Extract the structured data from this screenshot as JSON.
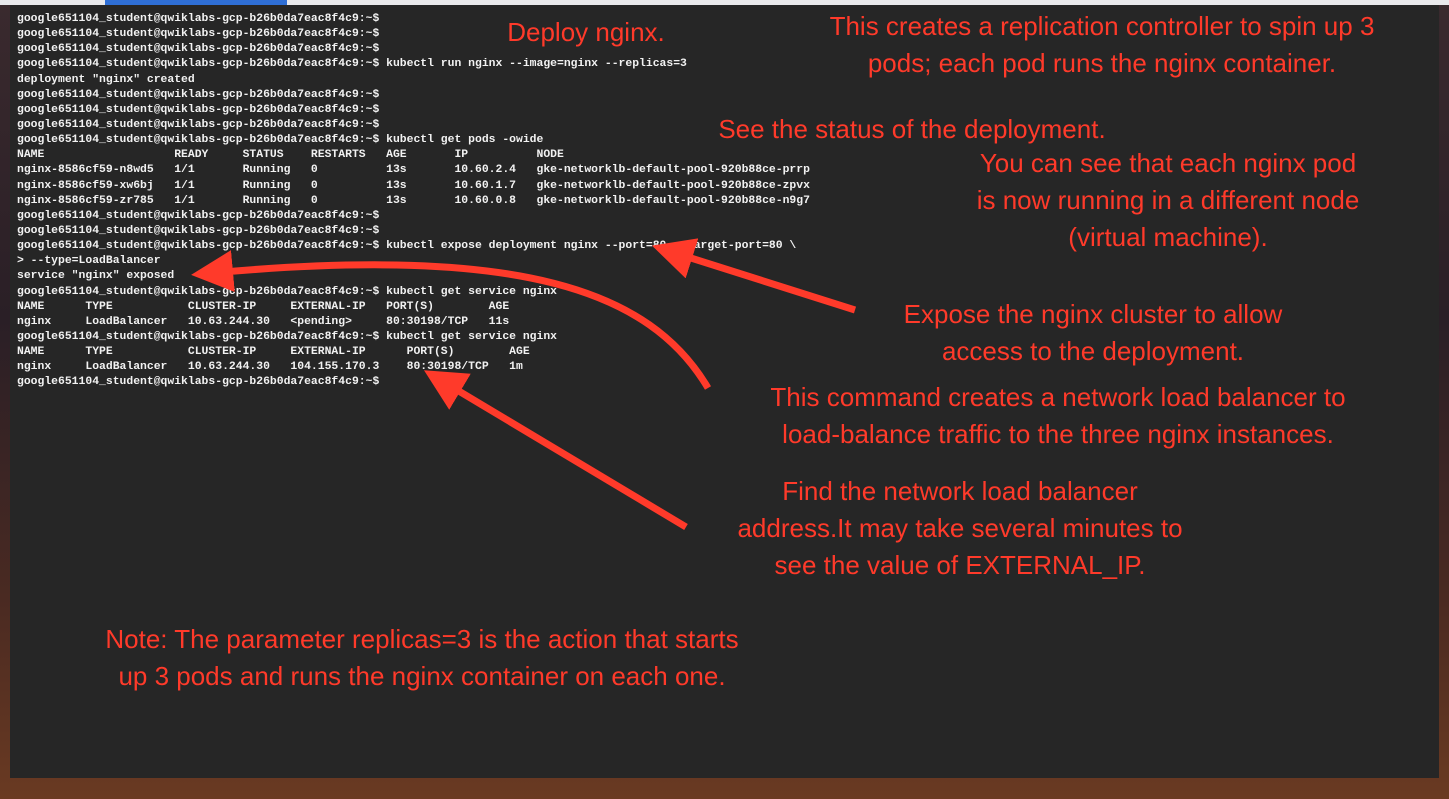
{
  "colors": {
    "terminal_bg": "#262626",
    "terminal_text": "#f2f2f2",
    "annotation_red": "#ff3a2a",
    "cursor": "#b8283a",
    "top_accent": "#2f6fd6"
  },
  "terminal": {
    "lines": [
      "google651104_student@qwiklabs-gcp-b26b0da7eac8f4c9:~$",
      "google651104_student@qwiklabs-gcp-b26b0da7eac8f4c9:~$",
      "google651104_student@qwiklabs-gcp-b26b0da7eac8f4c9:~$",
      "google651104_student@qwiklabs-gcp-b26b0da7eac8f4c9:~$ kubectl run nginx --image=nginx --replicas=3",
      "deployment \"nginx\" created",
      "google651104_student@qwiklabs-gcp-b26b0da7eac8f4c9:~$",
      "google651104_student@qwiklabs-gcp-b26b0da7eac8f4c9:~$",
      "google651104_student@qwiklabs-gcp-b26b0da7eac8f4c9:~$",
      "google651104_student@qwiklabs-gcp-b26b0da7eac8f4c9:~$ kubectl get pods -owide",
      "NAME                   READY     STATUS    RESTARTS   AGE       IP          NODE",
      "nginx-8586cf59-n8wd5   1/1       Running   0          13s       10.60.2.4   gke-networklb-default-pool-920b88ce-prrp",
      "nginx-8586cf59-xw6bj   1/1       Running   0          13s       10.60.1.7   gke-networklb-default-pool-920b88ce-zpvx",
      "nginx-8586cf59-zr785   1/1       Running   0          13s       10.60.0.8   gke-networklb-default-pool-920b88ce-n9g7",
      "google651104_student@qwiklabs-gcp-b26b0da7eac8f4c9:~$",
      "google651104_student@qwiklabs-gcp-b26b0da7eac8f4c9:~$",
      "google651104_student@qwiklabs-gcp-b26b0da7eac8f4c9:~$ kubectl expose deployment nginx --port=80 --target-port=80 \\",
      "> --type=LoadBalancer",
      "service \"nginx\" exposed",
      "google651104_student@qwiklabs-gcp-b26b0da7eac8f4c9:~$ kubectl get service nginx",
      "NAME      TYPE           CLUSTER-IP     EXTERNAL-IP   PORT(S)        AGE",
      "nginx     LoadBalancer   10.63.244.30   <pending>     80:30198/TCP   11s",
      "google651104_student@qwiklabs-gcp-b26b0da7eac8f4c9:~$ kubectl get service nginx",
      "NAME      TYPE           CLUSTER-IP     EXTERNAL-IP      PORT(S)        AGE",
      "nginx     LoadBalancer   10.63.244.30   104.155.170.3    80:30198/TCP   1m",
      "google651104_student@qwiklabs-gcp-b26b0da7eac8f4c9:~$"
    ]
  },
  "annotations": {
    "deploy": {
      "lines": [
        "Deploy nginx."
      ]
    },
    "replication": {
      "lines": [
        "This creates a replication controller to spin up 3",
        "pods; each pod runs the nginx container."
      ]
    },
    "status": {
      "lines": [
        "See the status of the deployment."
      ]
    },
    "nodes": {
      "lines": [
        "You can see that each nginx pod",
        "is now running in a different node",
        "(virtual machine)."
      ]
    },
    "expose": {
      "lines": [
        "Expose the nginx cluster to allow",
        "access to the deployment."
      ]
    },
    "loadbalancer": {
      "lines": [
        "This command creates a network load balancer to",
        "load-balance traffic to the three nginx instances."
      ]
    },
    "find": {
      "lines": [
        "Find the network load balancer",
        "address.It may take several minutes to",
        "see the value of EXTERNAL_IP."
      ]
    },
    "note": {
      "lines": [
        "Note: The parameter replicas=3 is the action that starts",
        "up 3 pods and runs the nginx container on each one."
      ]
    }
  }
}
